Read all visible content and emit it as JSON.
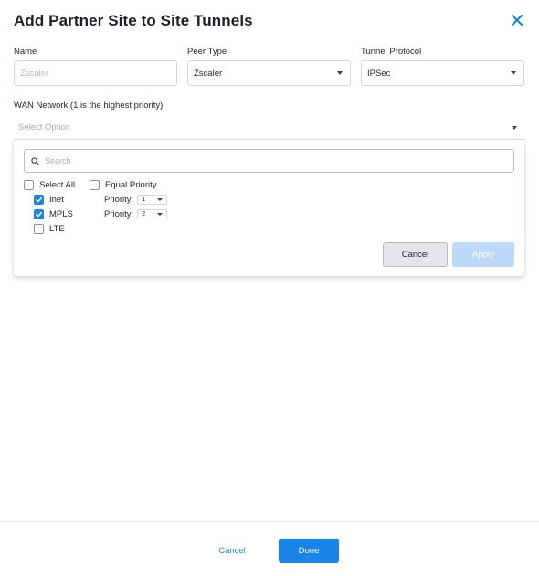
{
  "dialog": {
    "title": "Add Partner Site to Site Tunnels",
    "close_icon": "close-icon"
  },
  "form": {
    "name_label": "Name",
    "name_placeholder": "Zscaler",
    "peer_type_label": "Peer Type",
    "peer_type_value": "Zscaler",
    "tunnel_protocol_label": "Tunnel Protocol",
    "tunnel_protocol_value": "IPSec",
    "wan_label": "WAN Network (1 is the highest priority)",
    "wan_placeholder": "Select Option"
  },
  "dropdown": {
    "search_placeholder": "Search",
    "search_icon": "search-icon",
    "select_all_label": "Select All",
    "select_all_checked": false,
    "equal_priority_label": "Equal Priority",
    "equal_priority_checked": false,
    "priority_label": "Priority:",
    "options": [
      {
        "label": "Inet",
        "checked": true,
        "priority": "1"
      },
      {
        "label": "MPLS",
        "checked": true,
        "priority": "2"
      },
      {
        "label": "LTE",
        "checked": false,
        "priority": ""
      }
    ],
    "cancel_label": "Cancel",
    "apply_label": "Apply"
  },
  "footer": {
    "cancel_label": "Cancel",
    "done_label": "Done"
  },
  "colors": {
    "accent": "#1a84e6",
    "apply_disabled": "#bcdaf8"
  }
}
